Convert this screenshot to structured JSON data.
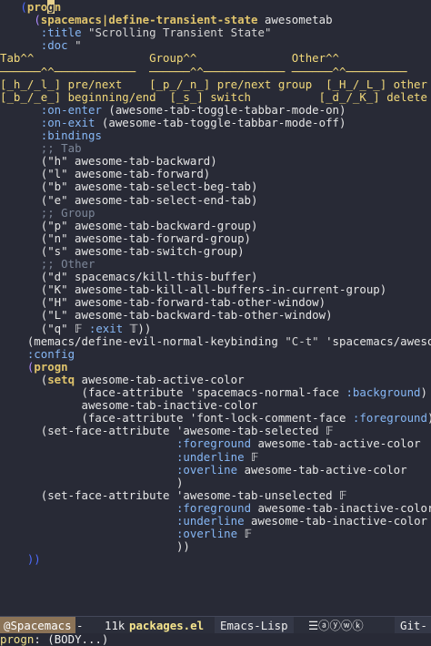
{
  "editor": {
    "lines": [
      [
        {
          "t": "   "
        },
        {
          "t": "(",
          "c": "par1"
        },
        {
          "t": "pro",
          "c": "kw"
        },
        {
          "t": "g",
          "c": "kw cursor"
        },
        {
          "t": "n",
          "c": "kw"
        }
      ],
      [
        {
          "t": "     "
        },
        {
          "t": "(",
          "c": "par2"
        },
        {
          "t": "spacemacs|define-transient-state",
          "c": "kw"
        },
        {
          "t": " awesometab"
        }
      ],
      [
        {
          "t": "      "
        },
        {
          "t": ":title",
          "c": "key"
        },
        {
          "t": " "
        },
        {
          "t": "\"Scrolling Transient State\"",
          "c": "str"
        }
      ],
      [
        {
          "t": "      "
        },
        {
          "t": ":doc",
          "c": "key"
        },
        {
          "t": " "
        },
        {
          "t": "\"",
          "c": "str"
        }
      ],
      [
        {
          "t": "Tab^^                 Group^^              Other^^",
          "c": "fn"
        }
      ],
      [
        {
          "t": "──────^^────────────  ──────^^──────────── ──────^^─────────",
          "c": "fn"
        }
      ],
      [
        {
          "t": "[_h_/_l_] pre/next    [_p_/_n_] pre/next group  [_H_/_L_] other",
          "c": "fn"
        }
      ],
      [
        {
          "t": "[_b_/_e_] beginning/end  [_s_] switch          [_d_/_K_] delete",
          "c": "fn"
        }
      ],
      [
        {
          "t": "      "
        },
        {
          "t": ":on-enter",
          "c": "key"
        },
        {
          "t": " (awesome-tab-toggle-tabbar-mode-on)"
        }
      ],
      [
        {
          "t": "      "
        },
        {
          "t": ":on-exit",
          "c": "key"
        },
        {
          "t": " (awesome-tab-toggle-tabbar-mode-off)"
        }
      ],
      [
        {
          "t": "      "
        },
        {
          "t": ":bindings",
          "c": "key"
        }
      ],
      [
        {
          "t": "      "
        },
        {
          "t": ";; Tab",
          "c": "com"
        }
      ],
      [
        {
          "t": "      (\"h\" awesome-tab-backward)"
        }
      ],
      [
        {
          "t": "      (\"l\" awesome-tab-forward)"
        }
      ],
      [
        {
          "t": "      (\"b\" awesome-tab-select-beg-tab)"
        }
      ],
      [
        {
          "t": "      (\"e\" awesome-tab-select-end-tab)"
        }
      ],
      [
        {
          "t": "      "
        },
        {
          "t": ";; Group",
          "c": "com"
        }
      ],
      [
        {
          "t": "      (\"p\" awesome-tab-backward-group)"
        }
      ],
      [
        {
          "t": "      (\"n\" awesome-tab-forward-group)"
        }
      ],
      [
        {
          "t": "      (\"s\" awesome-tab-switch-group)"
        }
      ],
      [
        {
          "t": "      "
        },
        {
          "t": ";; Other",
          "c": "com"
        }
      ],
      [
        {
          "t": "      (\"d\" spacemacs/kill-this-buffer)"
        }
      ],
      [
        {
          "t": "      (\"K\" awesome-tab-kill-all-buffers-in-current-group)"
        }
      ],
      [
        {
          "t": "      (\"H\" awesome-tab-forward-tab-other-window)"
        }
      ],
      [
        {
          "t": "      (\"L\" awesome-tab-backward-tab-other-window)"
        }
      ],
      [
        {
          "t": "      (\"q\" 𝔽 "
        },
        {
          "t": ":exit",
          "c": "key"
        },
        {
          "t": " 𝕋))"
        }
      ],
      [
        {
          "t": "    (memacs/define-evil-normal-keybinding "
        },
        {
          "t": "\"C-t\"",
          "c": "str"
        },
        {
          "t": " 'spacemacs/awesometab"
        }
      ],
      [
        {
          "t": "    "
        },
        {
          "t": ":config",
          "c": "key"
        }
      ],
      [
        {
          "t": "    "
        },
        {
          "t": "(",
          "c": "par2"
        },
        {
          "t": "progn",
          "c": "kw"
        }
      ],
      [
        {
          "t": "      ("
        },
        {
          "t": "setq",
          "c": "kw"
        },
        {
          "t": " awesome-tab-active-color"
        }
      ],
      [
        {
          "t": "            (face-attribute 'spacemacs-normal-face "
        },
        {
          "t": ":background",
          "c": "key"
        },
        {
          "t": ")"
        }
      ],
      [
        {
          "t": "            awesome-tab-inactive-color"
        }
      ],
      [
        {
          "t": "            (face-attribute 'font-lock-comment-face "
        },
        {
          "t": ":foreground",
          "c": "key"
        },
        {
          "t": "))"
        }
      ],
      [
        {
          "t": "      (set-face-attribute 'awesome-tab-selected 𝔽"
        }
      ],
      [
        {
          "t": "                          "
        },
        {
          "t": ":foreground",
          "c": "key"
        },
        {
          "t": " awesome-tab-active-color"
        }
      ],
      [
        {
          "t": "                          "
        },
        {
          "t": ":underline",
          "c": "key"
        },
        {
          "t": " 𝔽"
        }
      ],
      [
        {
          "t": "                          "
        },
        {
          "t": ":overline",
          "c": "key"
        },
        {
          "t": " awesome-tab-active-color"
        }
      ],
      [
        {
          "t": "                          )"
        }
      ],
      [
        {
          "t": "      (set-face-attribute 'awesome-tab-unselected 𝔽"
        }
      ],
      [
        {
          "t": "                          "
        },
        {
          "t": ":foreground",
          "c": "key"
        },
        {
          "t": " awesome-tab-inactive-color"
        }
      ],
      [
        {
          "t": "                          "
        },
        {
          "t": ":underline",
          "c": "key"
        },
        {
          "t": " awesome-tab-inactive-color"
        }
      ],
      [
        {
          "t": "                          "
        },
        {
          "t": ":overline",
          "c": "key"
        },
        {
          "t": " 𝔽"
        }
      ],
      [
        {
          "t": "                          ))"
        }
      ],
      [
        {
          "t": "    "
        },
        {
          "t": "))",
          "c": "par1"
        }
      ]
    ]
  },
  "modeline": {
    "state": "@Spacemacs",
    "dash": "-",
    "size": "11k",
    "buffer": "packages.el",
    "mode": "Emacs-Lisp",
    "icons": "☰ⓐⓨⓦⓚ",
    "vcs": "Git-"
  },
  "minibuffer": {
    "fn": "progn",
    "rest": ": (BODY...)"
  }
}
